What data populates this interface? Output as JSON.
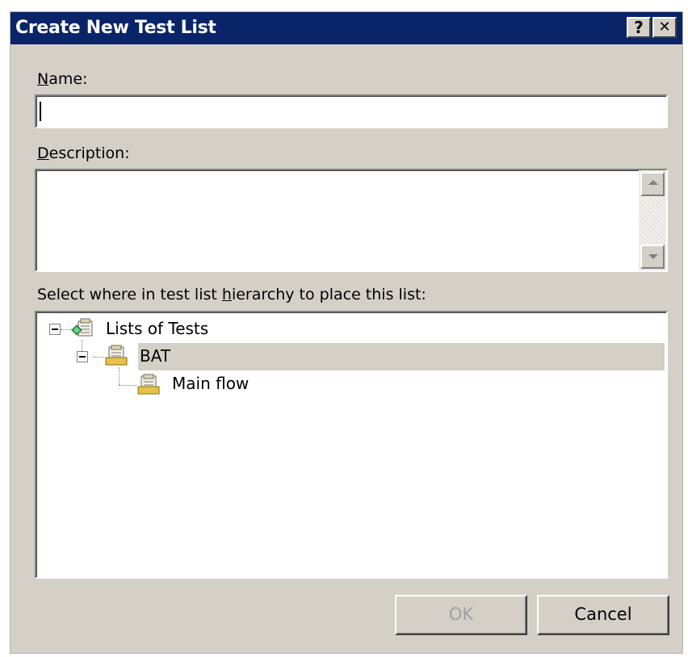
{
  "dialog": {
    "title": "Create New Test List",
    "help_button": "?",
    "close_button": "✕"
  },
  "name_field": {
    "label_prefix": "",
    "label_accel": "N",
    "label_rest": "ame:",
    "value": ""
  },
  "description_field": {
    "label_accel": "D",
    "label_rest": "escription:",
    "value": ""
  },
  "hierarchy": {
    "label_before": "Select where in test list ",
    "label_accel": "h",
    "label_after": "ierarchy to place this list:",
    "items": [
      {
        "label": "Lists of Tests",
        "icon": "test-list-root-icon",
        "level": 0,
        "expanded": true,
        "selected": false
      },
      {
        "label": "BAT",
        "icon": "test-list-folder-icon",
        "level": 1,
        "expanded": true,
        "selected": true
      },
      {
        "label": "Main flow",
        "icon": "test-list-folder-icon",
        "level": 2,
        "expanded": false,
        "selected": false
      }
    ]
  },
  "buttons": {
    "ok": "OK",
    "cancel": "Cancel",
    "ok_enabled": false
  },
  "colors": {
    "titlebar": "#0a246a",
    "dialog_bg": "#d4d0c8",
    "selection": "#d4d0c8",
    "disabled_text": "#a0a0a0"
  }
}
